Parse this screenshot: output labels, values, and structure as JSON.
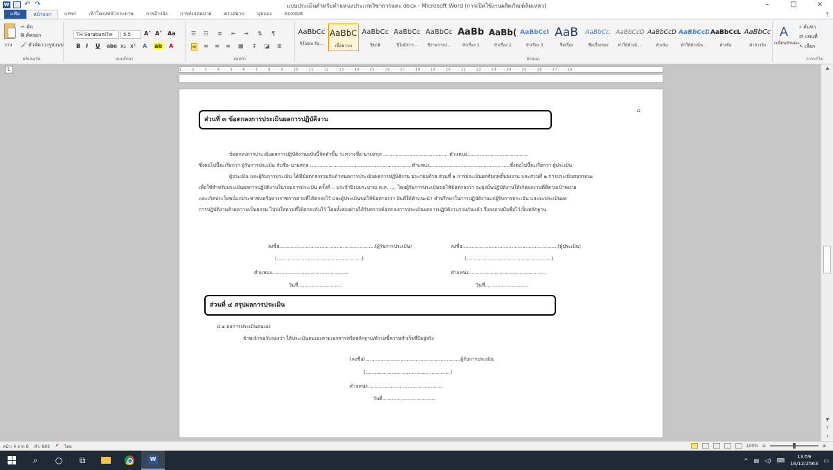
{
  "window": {
    "title": "แบบประเมินสำหรับตำแหน่งประเภทวิชาการและ.docx - Microsoft Word (การเปิดใช้งานผลิตภัณฑ์ล้มเหลว)",
    "minimize": "–",
    "maximize": "□",
    "close": "×"
  },
  "tabs": [
    {
      "label": "แฟ้ม"
    },
    {
      "label": "หน้าแรก"
    },
    {
      "label": "แทรก"
    },
    {
      "label": "เค้าโครงหน้ากระดาษ"
    },
    {
      "label": "การอ้างอิง"
    },
    {
      "label": "การส่งจดหมาย"
    },
    {
      "label": "ตรวจทาน"
    },
    {
      "label": "มุมมอง"
    },
    {
      "label": "Acrobat"
    }
  ],
  "ribbon": {
    "clipboard": {
      "label": "คลิปบอร์ด",
      "paste": "วาง",
      "cut": "ตัด",
      "copy": "คัดลอก",
      "format_painter": "ตัวคัดวางรูปแบบ"
    },
    "font": {
      "label": "แบบอักษร",
      "font_name": "TH SarabunIT๙",
      "font_size": "5.5",
      "bold": "B",
      "italic": "I",
      "underline": "U",
      "strike": "abe",
      "subscript": "x₂",
      "superscript": "x²"
    },
    "paragraph": {
      "label": "ย่อหน้า"
    },
    "styles": {
      "label": "ลักษณะ",
      "items": [
        {
          "sample": "AaBbCc",
          "name": "¶Table Pa..."
        },
        {
          "sample": "AaBbC",
          "name": "เนื้อความ"
        },
        {
          "sample": "AaBbCc",
          "name": "¶ปกติ"
        },
        {
          "sample": "AaBbCc",
          "name": "¶ไม่มีการ..."
        },
        {
          "sample": "AaBbCc",
          "name": "¶รายการย่..."
        },
        {
          "sample": "AaBb",
          "name": "หัวเรื่อง 1"
        },
        {
          "sample": "AaBb(",
          "name": "หัวเรื่อง 2"
        },
        {
          "sample": "AaBbCcI",
          "name": "หัวเรื่อง 3"
        },
        {
          "sample": "AaB",
          "name": "ชื่อเรื่อง"
        },
        {
          "sample": "AaBbCc.",
          "name": "ชื่อเรื่องรอง"
        },
        {
          "sample": "AaBbCcD",
          "name": "ทำให้ตัวเน้...."
        },
        {
          "sample": "AaBbCcD",
          "name": "ตัวเน้น"
        },
        {
          "sample": "AaBbCcD",
          "name": "ทำให้ตัวเน้น..."
        },
        {
          "sample": "AaBbCcL",
          "name": "ตัวเข้ม"
        },
        {
          "sample": "AaBbCc",
          "name": "คำอ้างอิง"
        }
      ],
      "change_styles": "เปลี่ยนลักษณะ"
    },
    "editing": {
      "label": "การแก้ไข",
      "find": "ค้นหา",
      "replace": "แทนที่",
      "select": "เลือก"
    }
  },
  "ruler": {
    "numbers": "1 · · · 2 · · · 3 · · · 4 · · · 5 · · · 6 · · · 7 · · · 8 · · · 9 · · · 10 · · · 11 · · · 12 · · · 13 · · · 14 · · · 15 · · · 16 · · · 17 · · · 18 · · · 19 · · · 20 · · · 21 · · · 22 · · · 23 · · · 24 · · · 25 · · · 26 · · · 27 · · · 28",
    "corner": "L"
  },
  "document": {
    "page_number": "๔",
    "section3_title": "ส่วนที่ ๓ ข้อตกลงการประเมินผลการปฏิบัติงาน",
    "para_lines": [
      "ข้อตกลงการประเมินผลการปฏิบัติงานฉบับนี้จัดทำขึ้น  ระหว่างชื่อ-นามสกุล  ..........................................  ตำแหน่ง.......................................",
      "ซึ่งต่อไปนี้จะเรียกว่า ผู้รับการประเมิน กับชื่อ-นามสกุล ..................................................................ตำแหน่ง....................................................ซึ่งต่อไปนี้จะเรียกว่า ผู้ประเมิน",
      "ผู้ประเมิน และผู้รับการประเมิน ได้มีข้อตกลงร่วมกันกำหนดการประเมินผลการปฏิบัติงาน ประกอบด้วย ส่วนที่ ๑ การประเมินผลสัมฤทธิ์ของงาน และส่วนที่ ๒ การประเมินสมรรถนะ",
      "เพื่อใช้สำหรับประเมินผลการปฏิบัติงานในรอบการประเมิน ครั้งที่ .. ประจำปีงบประมาณ พ.ศ. .... โดยผู้รับการประเมินขอให้ข้อตกลงว่า จะมุ่งมั่นปฏิบัติงานให้เกิดผลงานที่ดีตามเป้าหมาย",
      "และเกิดประโยชน์แก่ประชาชนหรือทางราชการตามที่ได้ตกลงไว้ และผู้ประเมินขอให้ข้อตกลงว่า ยินดีให้คำแนะนำ คำปรึกษาในการปฏิบัติงานแก่ผู้รับการประเมิน และจะประเมินผล",
      "การปฏิบัติงานด้วยความเป็นธรรม โปร่งใสตามที่ได้ตกลงกันไว้  โดยทั้งสองฝ่ายได้รับทราบข้อตกลงการประเมินผลการปฏิบัติงานร่วมกันแล้ว  จึงลงลายมือชื่อไว้เป็นหลักฐาน"
    ],
    "sig_left": {
      "sign": "ลงชื่อ..............................................................(ผู้รับการประเมิน)",
      "paren": "(.......................................................)",
      "position": "ตำแหน่ง..................................................",
      "date": "วันที่............................"
    },
    "sig_right": {
      "sign": "ลงชื่อ..............................................................(ผู้ประเมิน)",
      "paren": "(.......................................................)",
      "position": "ตำแหน่ง..................................................",
      "date": "วันที่............................"
    },
    "section4_title": "ส่วนที่ ๔ สรุปผลการประเมิน",
    "sub41": "๔.๑  ผลการประเมินตนเอง",
    "sub41_text": "ข้าพเจ้าขอรับรองว่า ได้ประเมินตนเองตามเอกสารหรือหลักฐาน/ตัวบ่งชี้ความสำเร็จที่มีอยู่จริง",
    "sig_self": {
      "sign": "(ลงชื่อ)..............................................................ผู้รับการประเมิน",
      "paren": "(.......................................................)",
      "position": "ตำแหน่ง.................................................",
      "date": "วันที่..................................."
    }
  },
  "status": {
    "page": "หน้า: 4 จาก 8",
    "words": "คำ: 802",
    "lang": "ไทย",
    "zoom": "100%"
  },
  "taskbar": {
    "time": "13:59",
    "date": "16/12/2563"
  }
}
